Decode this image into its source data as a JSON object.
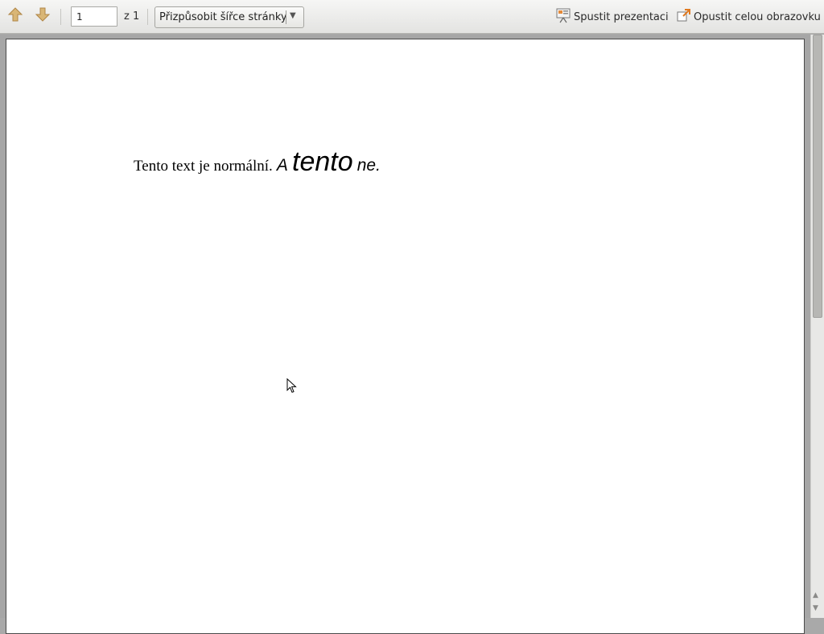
{
  "toolbar": {
    "prev_page_icon": "arrow-up-icon",
    "next_page_icon": "arrow-down-icon",
    "page_number": "1",
    "page_of": "z 1",
    "zoom_selected": "Přizpůsobit šířce stránky",
    "presentation_label": "Spustit prezentaci",
    "exit_fullscreen_label": "Opustit celou obrazovku"
  },
  "document": {
    "normal_text": "Tento text je normální.",
    "italic_a": "A",
    "big_italic": "tento",
    "italic_end": "ne."
  },
  "colors": {
    "toolbar_bg": "#ececea",
    "viewer_bg": "#a6a6a6",
    "page_bg": "#ffffff",
    "arrow_icon": "#c9a25c"
  }
}
